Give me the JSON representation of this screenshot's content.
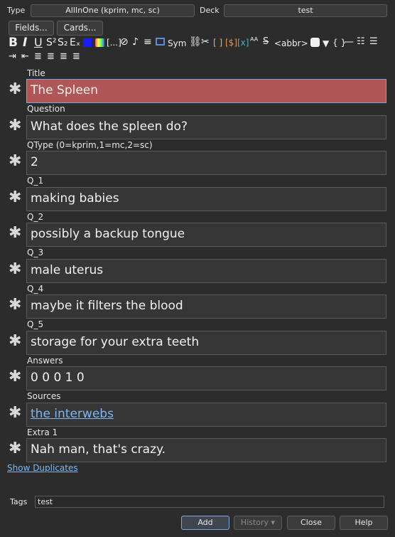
{
  "header": {
    "type_label": "Type",
    "type_value": "AllInOne (kprim, mc, sc)",
    "deck_label": "Deck",
    "deck_value": "test",
    "fields_button": "Fields...",
    "cards_button": "Cards..."
  },
  "toolbar": {
    "bold": "B",
    "italic": "I",
    "underline": "U",
    "superscript": "S²",
    "subscript": "S₂",
    "clear_format": "Eₓ",
    "text_color": "#1a1aff",
    "cloze": "[...]",
    "symbols": "Sym",
    "abbr": "<abbr>",
    "braces": "{ }"
  },
  "fields": [
    {
      "label": "Title",
      "value": "The Spleen",
      "active": true
    },
    {
      "label": "Question",
      "value": "What does the spleen do?"
    },
    {
      "label": "QType (0=kprim,1=mc,2=sc)",
      "value": "2"
    },
    {
      "label": "Q_1",
      "value": "making babies"
    },
    {
      "label": "Q_2",
      "value": "possibly a backup tongue"
    },
    {
      "label": "Q_3",
      "value": "male uterus"
    },
    {
      "label": "Q_4",
      "value": "maybe it filters the blood"
    },
    {
      "label": "Q_5",
      "value": "storage for your extra teeth"
    },
    {
      "label": "Answers",
      "value": "0 0 0 1 0"
    },
    {
      "label": "Sources",
      "value": "the interwebs",
      "is_link": true
    },
    {
      "label": "Extra 1",
      "value": "Nah man, that's crazy."
    }
  ],
  "show_duplicates": "Show Duplicates",
  "tags": {
    "label": "Tags",
    "value": "test"
  },
  "buttons": {
    "add": "Add",
    "history": "History ▾",
    "close": "Close",
    "help": "Help"
  },
  "colors": {
    "active_field": "#b05656",
    "link": "#7cb7f2",
    "background": "#2c2c2c"
  }
}
